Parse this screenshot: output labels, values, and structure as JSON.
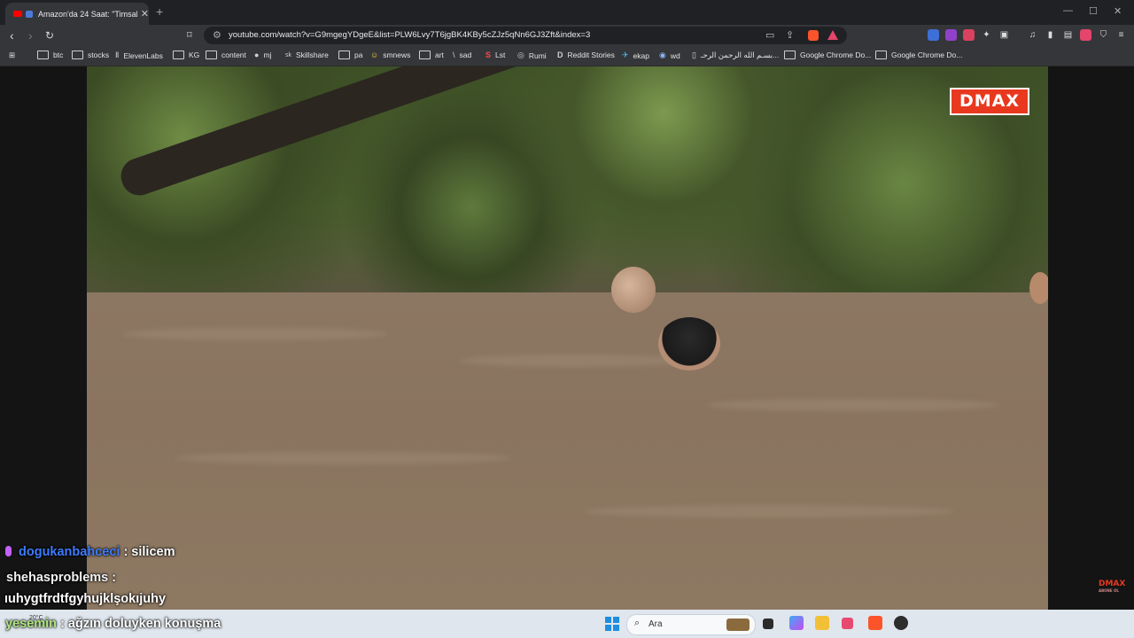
{
  "browser": {
    "tab_title": "Amazon'da 24 Saat: \"Timsah...",
    "url": "youtube.com/watch?v=G9mgegYDgeE&list=PLW6Lvy7T6jgBK4KBy5cZJz5qNn6GJ3Zft&index=3",
    "new_tab_symbol": "+",
    "close_symbol": "✕",
    "window_controls": [
      "—",
      "☐",
      "✕"
    ]
  },
  "bookmarks": [
    {
      "label": "btc",
      "icon": "folder-icon"
    },
    {
      "label": "stocks",
      "icon": "folder-icon"
    },
    {
      "label": "ElevenLabs",
      "icon": "elevenlabs-icon",
      "glyph": "Ⅱ"
    },
    {
      "label": "KG",
      "icon": "folder-icon"
    },
    {
      "label": "content",
      "icon": "folder-icon"
    },
    {
      "label": "mj",
      "icon": "github-icon",
      "glyph": "●"
    },
    {
      "label": "Skillshare",
      "icon": "skillshare-icon",
      "glyph": "sk"
    },
    {
      "label": "pa",
      "icon": "folder-icon"
    },
    {
      "label": "smnews",
      "icon": "smiley-icon",
      "glyph": "☺"
    },
    {
      "label": "art",
      "icon": "folder-icon"
    },
    {
      "label": "sad",
      "icon": "slash-icon",
      "glyph": "\\"
    },
    {
      "label": "Lst",
      "icon": "s-icon",
      "glyph": "S"
    },
    {
      "label": "Rumi",
      "icon": "globe-icon",
      "glyph": "◎"
    },
    {
      "label": "Reddit Stories",
      "icon": "d-icon",
      "glyph": "D"
    },
    {
      "label": "ekap",
      "icon": "bird-icon",
      "glyph": "✈"
    },
    {
      "label": "wd",
      "icon": "wd-icon",
      "glyph": "◉"
    },
    {
      "label": "بسـم الله الرحمن الرحـ...",
      "icon": "page-icon",
      "glyph": "▯"
    },
    {
      "label": "Google Chrome Do...",
      "icon": "folder-icon"
    },
    {
      "label": "Google Chrome Do...",
      "icon": "folder-icon"
    }
  ],
  "video": {
    "logo": "DMAX",
    "small_logo": "DMAX",
    "small_logo_sub": "ABONE OL"
  },
  "chat": [
    {
      "user": "dogukanbahceci",
      "message": ": silicem",
      "mic": true
    },
    {
      "user": "shehasproblems :",
      "message": ""
    },
    {
      "user": "",
      "message": "ıuhygtfrdtfgyhujklşokıjuhy"
    },
    {
      "user": "yesemin",
      "message": ": ağzın doluyken konuşma"
    }
  ],
  "taskbar": {
    "weather": "20°C",
    "search_label": "Ara"
  },
  "colors": {
    "accent_red": "#e8391f",
    "chat_user_blue": "#3d7bff"
  }
}
